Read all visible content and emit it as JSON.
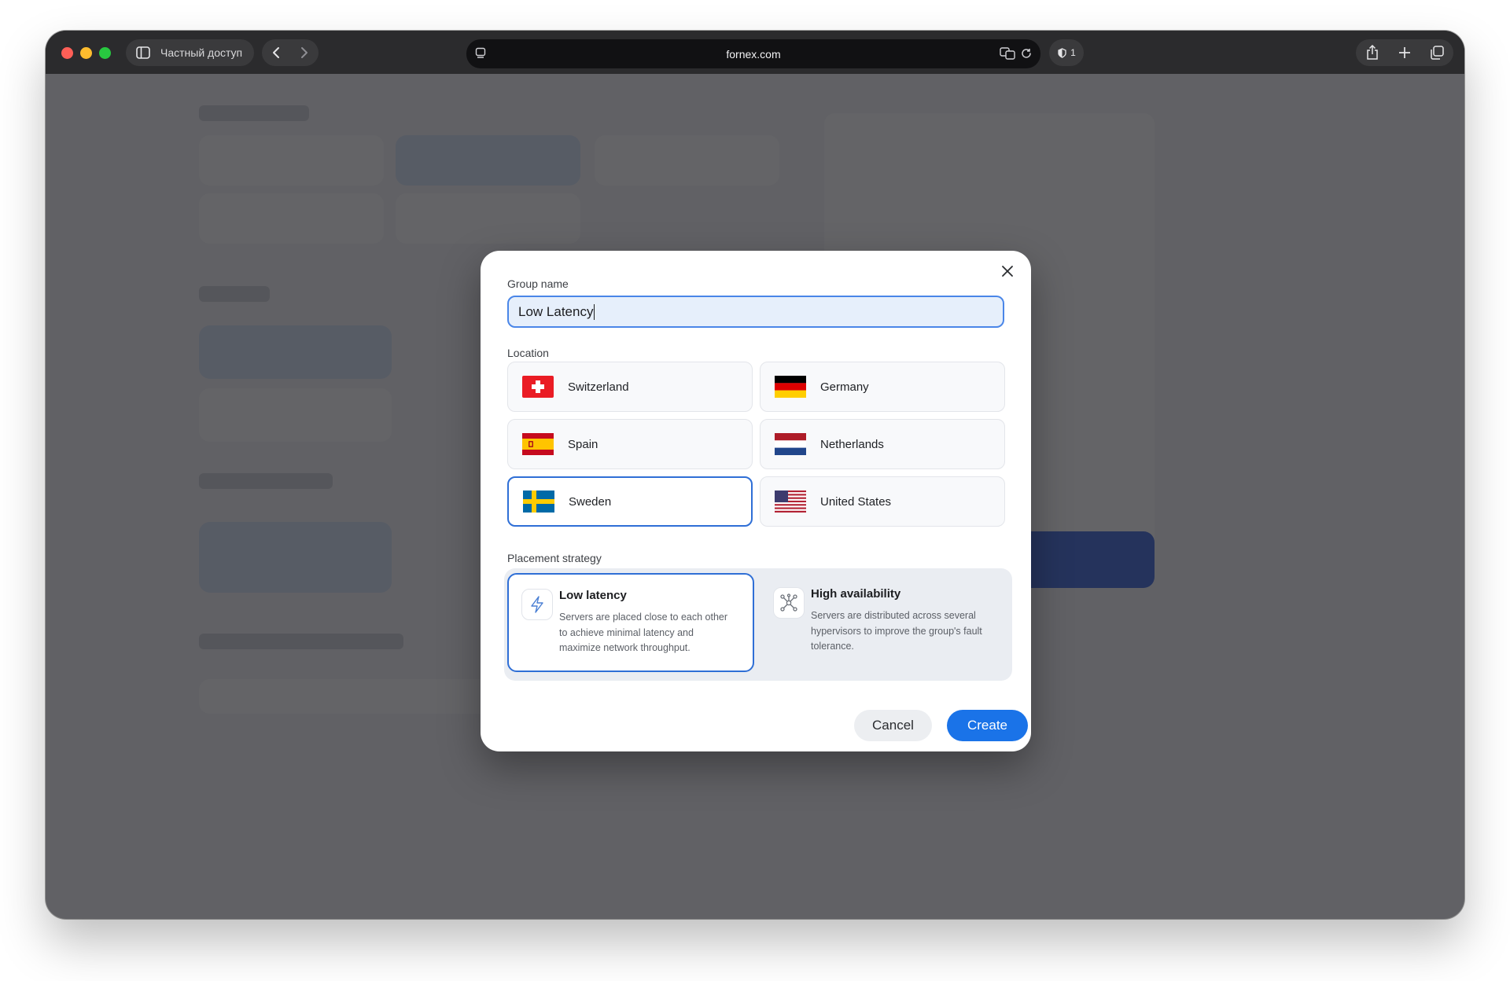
{
  "browser": {
    "private_label": "Частный доступ",
    "url": "fornex.com",
    "shield_count": "1"
  },
  "modal": {
    "group_name_label": "Group name",
    "group_name_value": "Low Latency",
    "location_label": "Location",
    "locations": [
      {
        "name": "Switzerland",
        "selected": false
      },
      {
        "name": "Germany",
        "selected": false
      },
      {
        "name": "Spain",
        "selected": false
      },
      {
        "name": "Netherlands",
        "selected": false
      },
      {
        "name": "Sweden",
        "selected": true
      },
      {
        "name": "United States",
        "selected": false
      }
    ],
    "placement_label": "Placement strategy",
    "strategies": [
      {
        "title": "Low latency",
        "description": "Servers are placed close to each other to achieve minimal latency and maximize network throughput.",
        "icon": "lightning-icon",
        "selected": true
      },
      {
        "title": "High availability",
        "description": "Servers are distributed across several hypervisors to improve the group's fault tolerance.",
        "icon": "network-nodes-icon",
        "selected": false
      }
    ],
    "cancel_label": "Cancel",
    "create_label": "Create"
  },
  "colors": {
    "accent": "#1a73e8",
    "selected_border": "#2f6fd6",
    "input_bg": "#e6effb"
  }
}
